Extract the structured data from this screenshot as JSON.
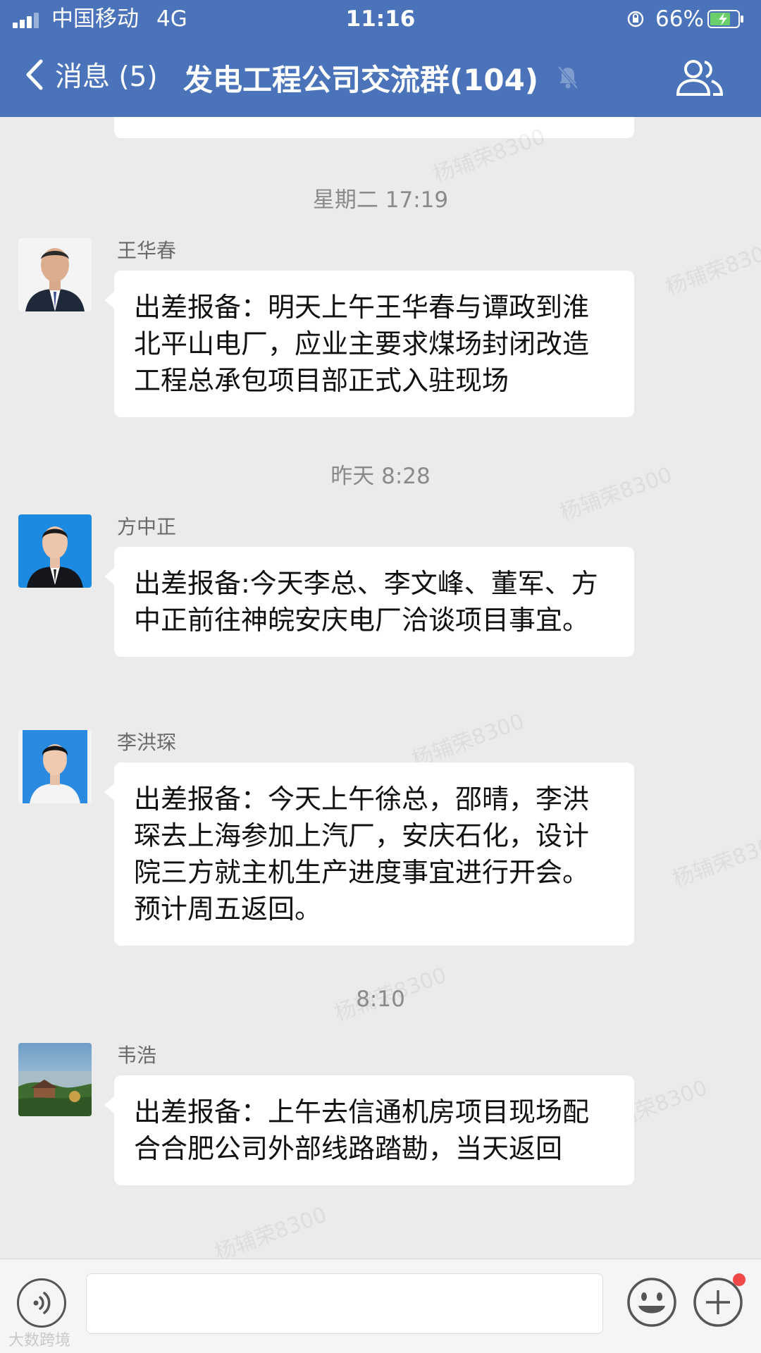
{
  "status_bar": {
    "carrier": "中国移动",
    "network": "4G",
    "time": "11:16",
    "battery_percent": "66%"
  },
  "nav": {
    "back_label": "消息 (5)",
    "title": "发电工程公司交流群(104)"
  },
  "chat": {
    "items": [
      {
        "timestamp": "星期二 17:19"
      },
      {
        "sender": "王华春",
        "text": "出差报备：明天上午王华春与谭政到淮北平山电厂，应业主要求煤场封闭改造工程总承包项目部正式入驻现场"
      },
      {
        "timestamp": "昨天 8:28"
      },
      {
        "sender": "方中正",
        "text": "出差报备:今天李总、李文峰、董军、方中正前往神皖安庆电厂洽谈项目事宜。"
      },
      {
        "sender": "李洪琛",
        "text": "出差报备：今天上午徐总，邵晴，李洪琛去上海参加上汽厂，安庆石化，设计院三方就主机生产进度事宜进行开会。预计周五返回。"
      },
      {
        "timestamp": "8:10"
      },
      {
        "sender": "韦浩",
        "text": "出差报备：上午去信通机房项目现场配合合肥公司外部线路踏勘，当天返回"
      }
    ]
  },
  "watermark_text": "杨辅荣8300",
  "corner_brand": "大数跨境",
  "colors": {
    "nav_bg": "#4a73b9",
    "chat_bg": "#ebebeb",
    "bubble_bg": "#ffffff",
    "badge_red": "#f04848"
  },
  "icons": {
    "back": "chevron-left-icon",
    "mute": "bell-off-icon",
    "members": "group-members-icon",
    "voice": "voice-icon",
    "emoji": "emoji-icon",
    "plus": "plus-icon"
  }
}
